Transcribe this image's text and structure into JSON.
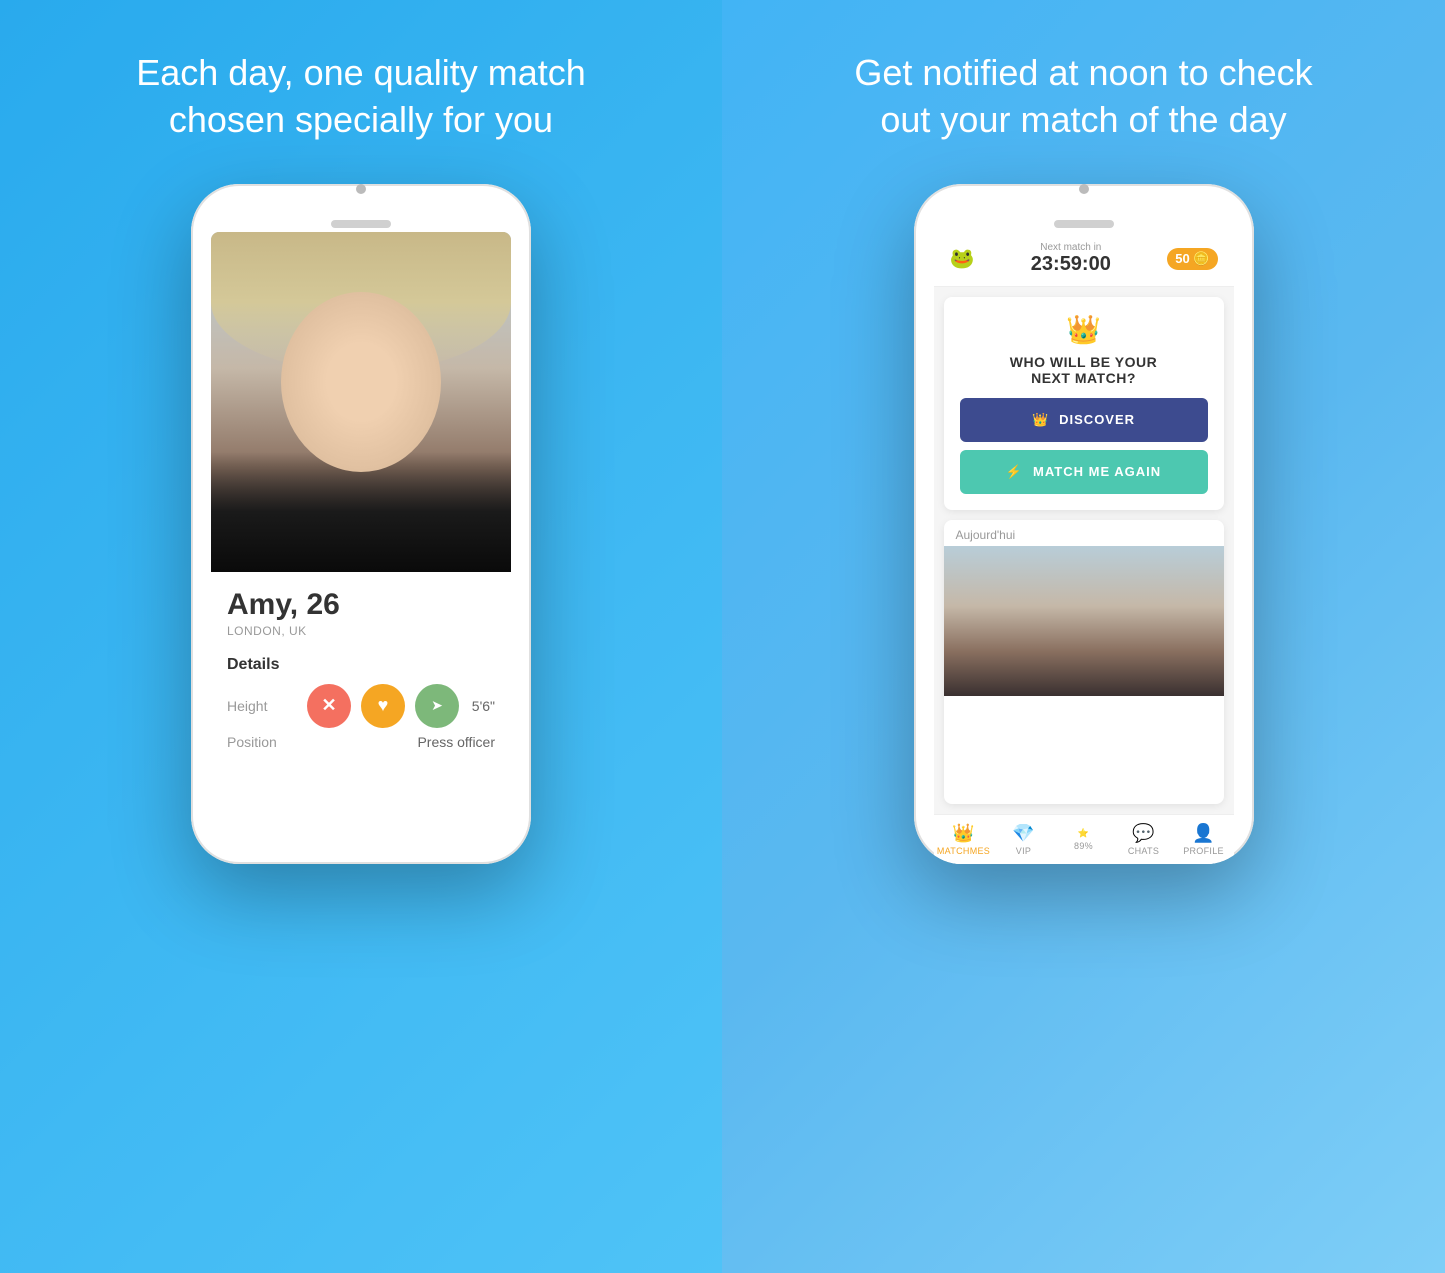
{
  "left": {
    "title_line1": "Each day, one quality match",
    "title_line2": "chosen specially for you",
    "profile": {
      "name": "Amy, 26",
      "location": "LONDON, UK",
      "details_label": "Details",
      "height_key": "Height",
      "height_val": "5'6\"",
      "position_key": "Position",
      "position_val": "Press officer"
    },
    "buttons": {
      "x": "✕",
      "heart": "♥",
      "send": "➤"
    }
  },
  "right": {
    "title_line1": "Get notified at noon to check",
    "title_line2": "out your match of the day",
    "app": {
      "logo": "🐸",
      "next_match_label": "Next match in",
      "next_match_time": "23:59:00",
      "coin_count": "50",
      "who_text": "WHO WILL BE YOUR\nNEXT MATCH?",
      "discover_label": "DISCOVER",
      "match_again_label": "MATCH ME AGAIN",
      "today_label": "Aujourd'hui"
    },
    "nav": {
      "matchmes_label": "MATCHMES",
      "vip_label": "VIP",
      "pct": "89%",
      "chats_label": "CHATS",
      "profile_label": "PROFILE"
    }
  }
}
